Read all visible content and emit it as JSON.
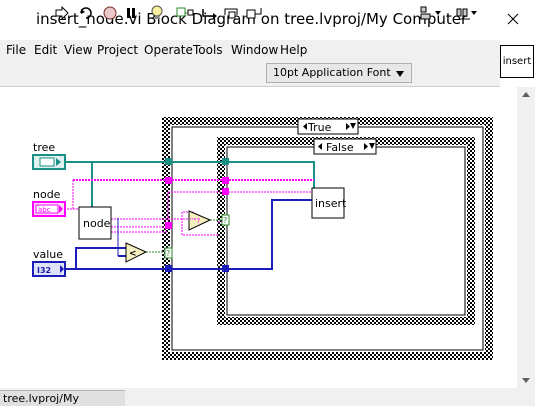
{
  "window": {
    "title": "insert_node.vi Block Diagram on tree.lvproj/My Computer"
  },
  "menu": {
    "items": [
      "File",
      "Edit",
      "View",
      "Project",
      "Operate",
      "Tools",
      "Window",
      "Help"
    ]
  },
  "toolbar": {
    "font_selector": "10pt Application Font",
    "context_help_label": "insert"
  },
  "diagram": {
    "controls": {
      "tree_label": "tree",
      "node_label": "node",
      "node_type": "abc",
      "value_label": "value",
      "value_type": "I32"
    },
    "nodes": {
      "node_subvi": "node",
      "insert_subvi": "insert",
      "compare_symbol": "<"
    },
    "outer_case": {
      "selector": "True"
    },
    "inner_case": {
      "selector": "False"
    }
  },
  "status": {
    "project_path": "tree.lvproj/My Computer"
  },
  "colors": {
    "wire_teal": "#1a8f86",
    "wire_pink": "#ff00ff",
    "wire_blue": "#1c1cb8",
    "case_frame": "#000000"
  }
}
